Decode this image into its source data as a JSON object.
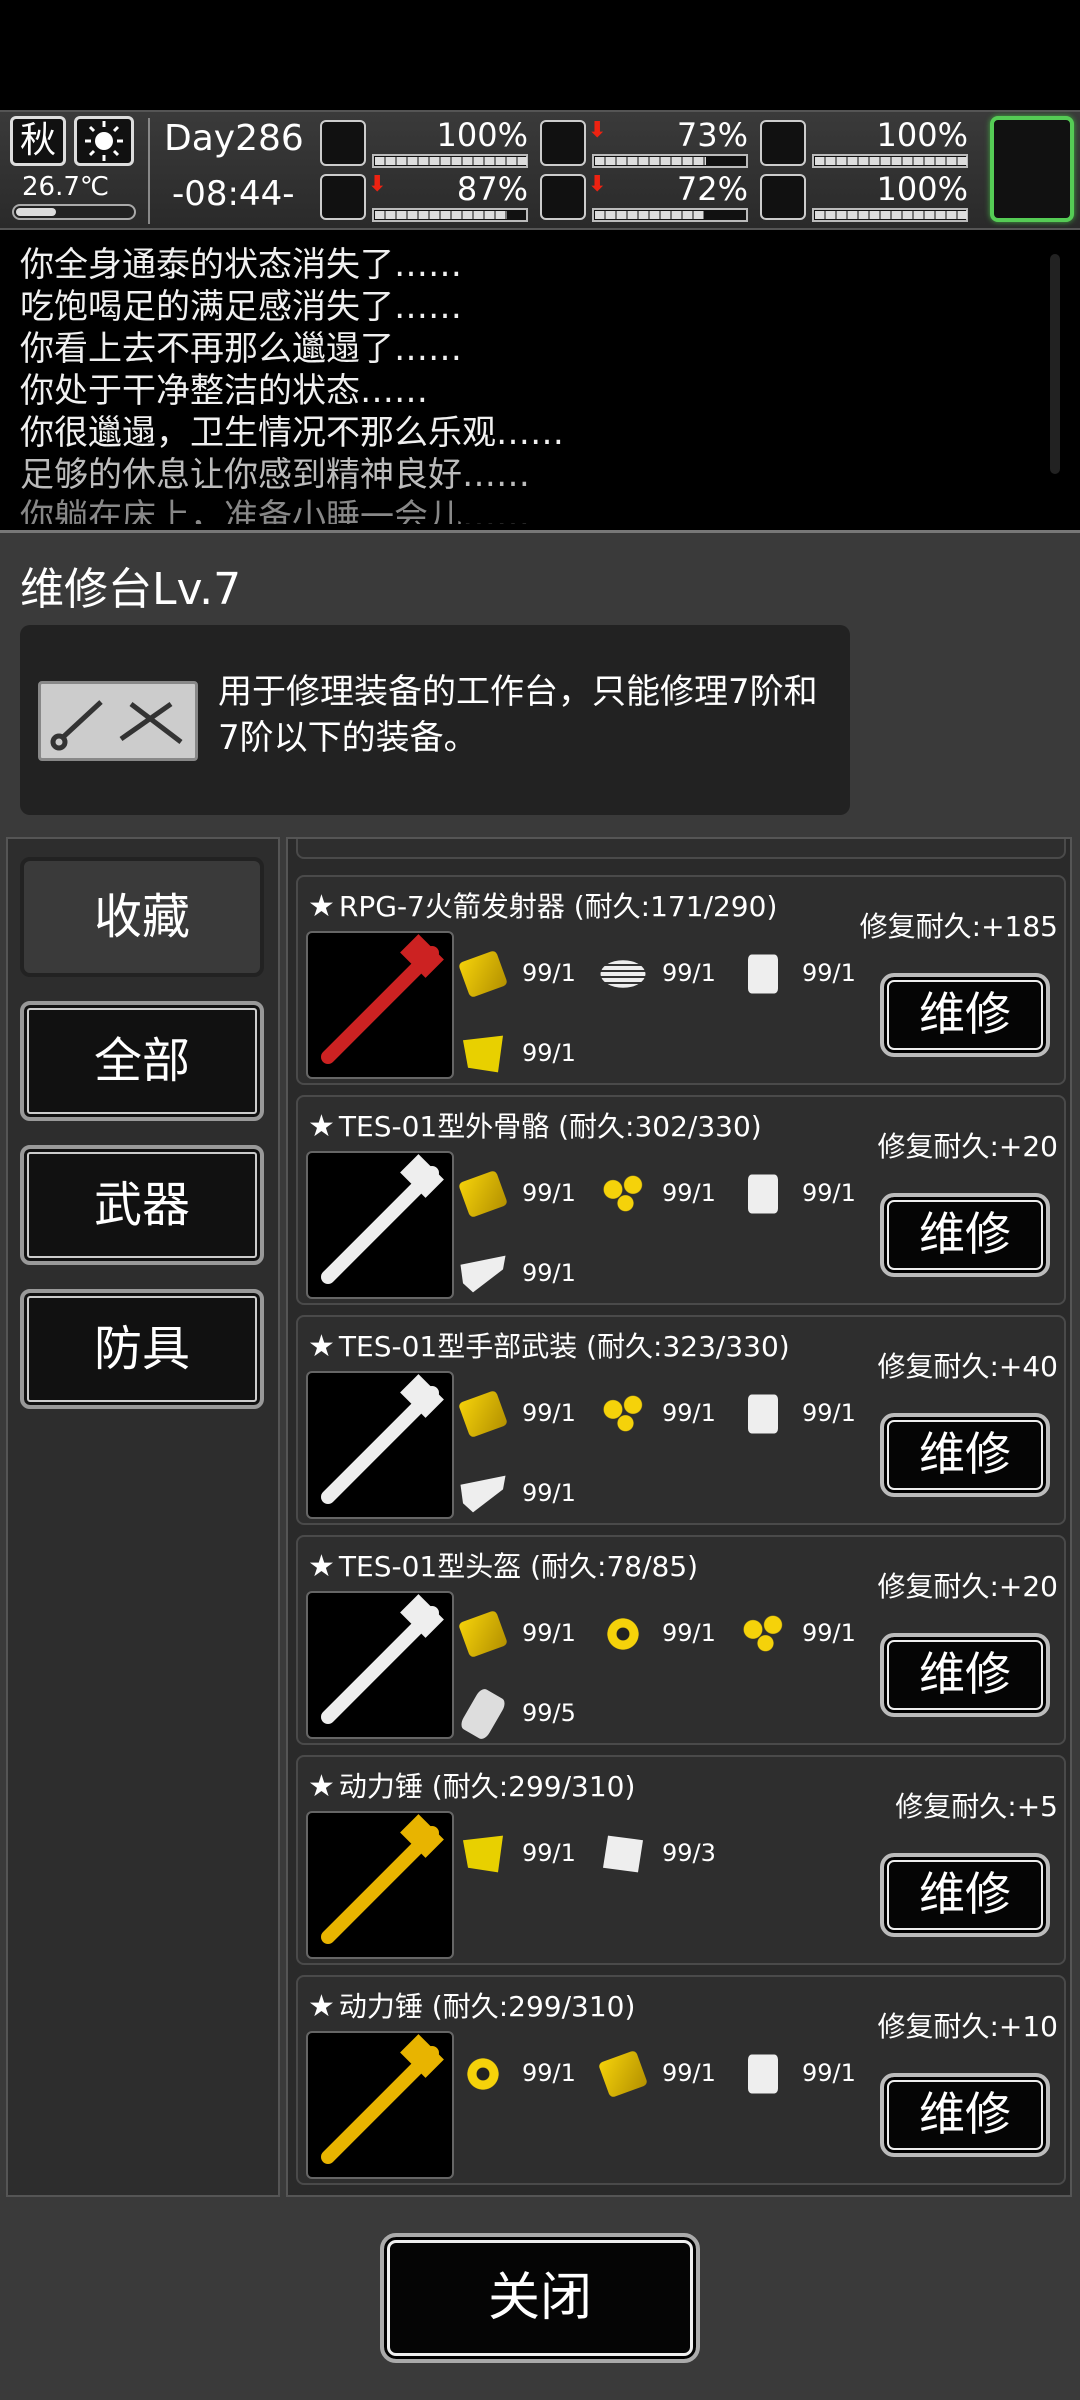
{
  "status": {
    "season": "秋",
    "weather_icon": "sun-icon",
    "temperature": "26.7℃",
    "day": "Day286",
    "time": "-08:44-",
    "stats": [
      {
        "icon": "medkit-icon",
        "value": "100%",
        "level": 1.0,
        "down": false
      },
      {
        "icon": "stomach-icon",
        "value": "73%",
        "level": 0.73,
        "down": true
      },
      {
        "icon": "bladder-icon",
        "value": "100%",
        "level": 1.0,
        "down": false
      },
      {
        "icon": "boot-icon",
        "value": "87%",
        "level": 0.87,
        "down": true
      },
      {
        "icon": "water-drop-icon",
        "value": "72%",
        "level": 0.72,
        "down": true
      },
      {
        "icon": "heart-icon",
        "value": "100%",
        "level": 1.0,
        "down": false
      }
    ]
  },
  "log": [
    "你全身通泰的状态消失了……",
    "吃饱喝足的满足感消失了……",
    "你看上去不再那么邋遢了……",
    "你处于干净整洁的状态……",
    "你很邋遢，卫生情况不那么乐观……",
    "足够的休息让你感到精神良好……",
    "你躺在床上，准备小睡一会儿……"
  ],
  "panel": {
    "title": "维修台Lv.7",
    "description": "用于修理装备的工作台，只能修理7阶和7阶以下的装备。",
    "categories": [
      "收藏",
      "全部",
      "武器",
      "防具"
    ],
    "close_label": "关闭"
  },
  "items": [
    {
      "name": "RPG-7火箭发射器 (耐久:171/290)",
      "repair": "修复耐久:+185",
      "button": "维修",
      "mats": [
        {
          "icon": "card-y",
          "v": "99/1"
        },
        {
          "icon": "roll",
          "v": "99/1"
        },
        {
          "icon": "jug",
          "v": "99/1"
        },
        {
          "icon": "chip",
          "v": "99/1"
        }
      ]
    },
    {
      "name": "TES-01型外骨骼 (耐久:302/330)",
      "repair": "修复耐久:+20",
      "button": "维修",
      "mats": [
        {
          "icon": "card-y",
          "v": "99/1"
        },
        {
          "icon": "scrap",
          "v": "99/1"
        },
        {
          "icon": "jug",
          "v": "99/1"
        },
        {
          "icon": "tool",
          "v": "99/1"
        }
      ]
    },
    {
      "name": "TES-01型手部武装 (耐久:323/330)",
      "repair": "修复耐久:+40",
      "button": "维修",
      "mats": [
        {
          "icon": "card-y",
          "v": "99/1"
        },
        {
          "icon": "scrap",
          "v": "99/1"
        },
        {
          "icon": "jug",
          "v": "99/1"
        },
        {
          "icon": "tool",
          "v": "99/1"
        }
      ]
    },
    {
      "name": "TES-01型头盔 (耐久:78/85)",
      "repair": "修复耐久:+20",
      "button": "维修",
      "mats": [
        {
          "icon": "card-y",
          "v": "99/1"
        },
        {
          "icon": "gear",
          "v": "99/1"
        },
        {
          "icon": "scrap",
          "v": "99/1"
        },
        {
          "icon": "scroll",
          "v": "99/5"
        }
      ]
    },
    {
      "name": "动力锤 (耐久:299/310)",
      "repair": "修复耐久:+5",
      "button": "维修",
      "mats": [
        {
          "icon": "chip",
          "v": "99/1"
        },
        {
          "icon": "paper",
          "v": "99/3"
        }
      ]
    },
    {
      "name": "动力锤 (耐久:299/310)",
      "repair": "修复耐久:+10",
      "button": "维修",
      "mats": [
        {
          "icon": "gear",
          "v": "99/1"
        },
        {
          "icon": "card-y",
          "v": "99/1"
        },
        {
          "icon": "jug",
          "v": "99/1"
        }
      ]
    }
  ]
}
